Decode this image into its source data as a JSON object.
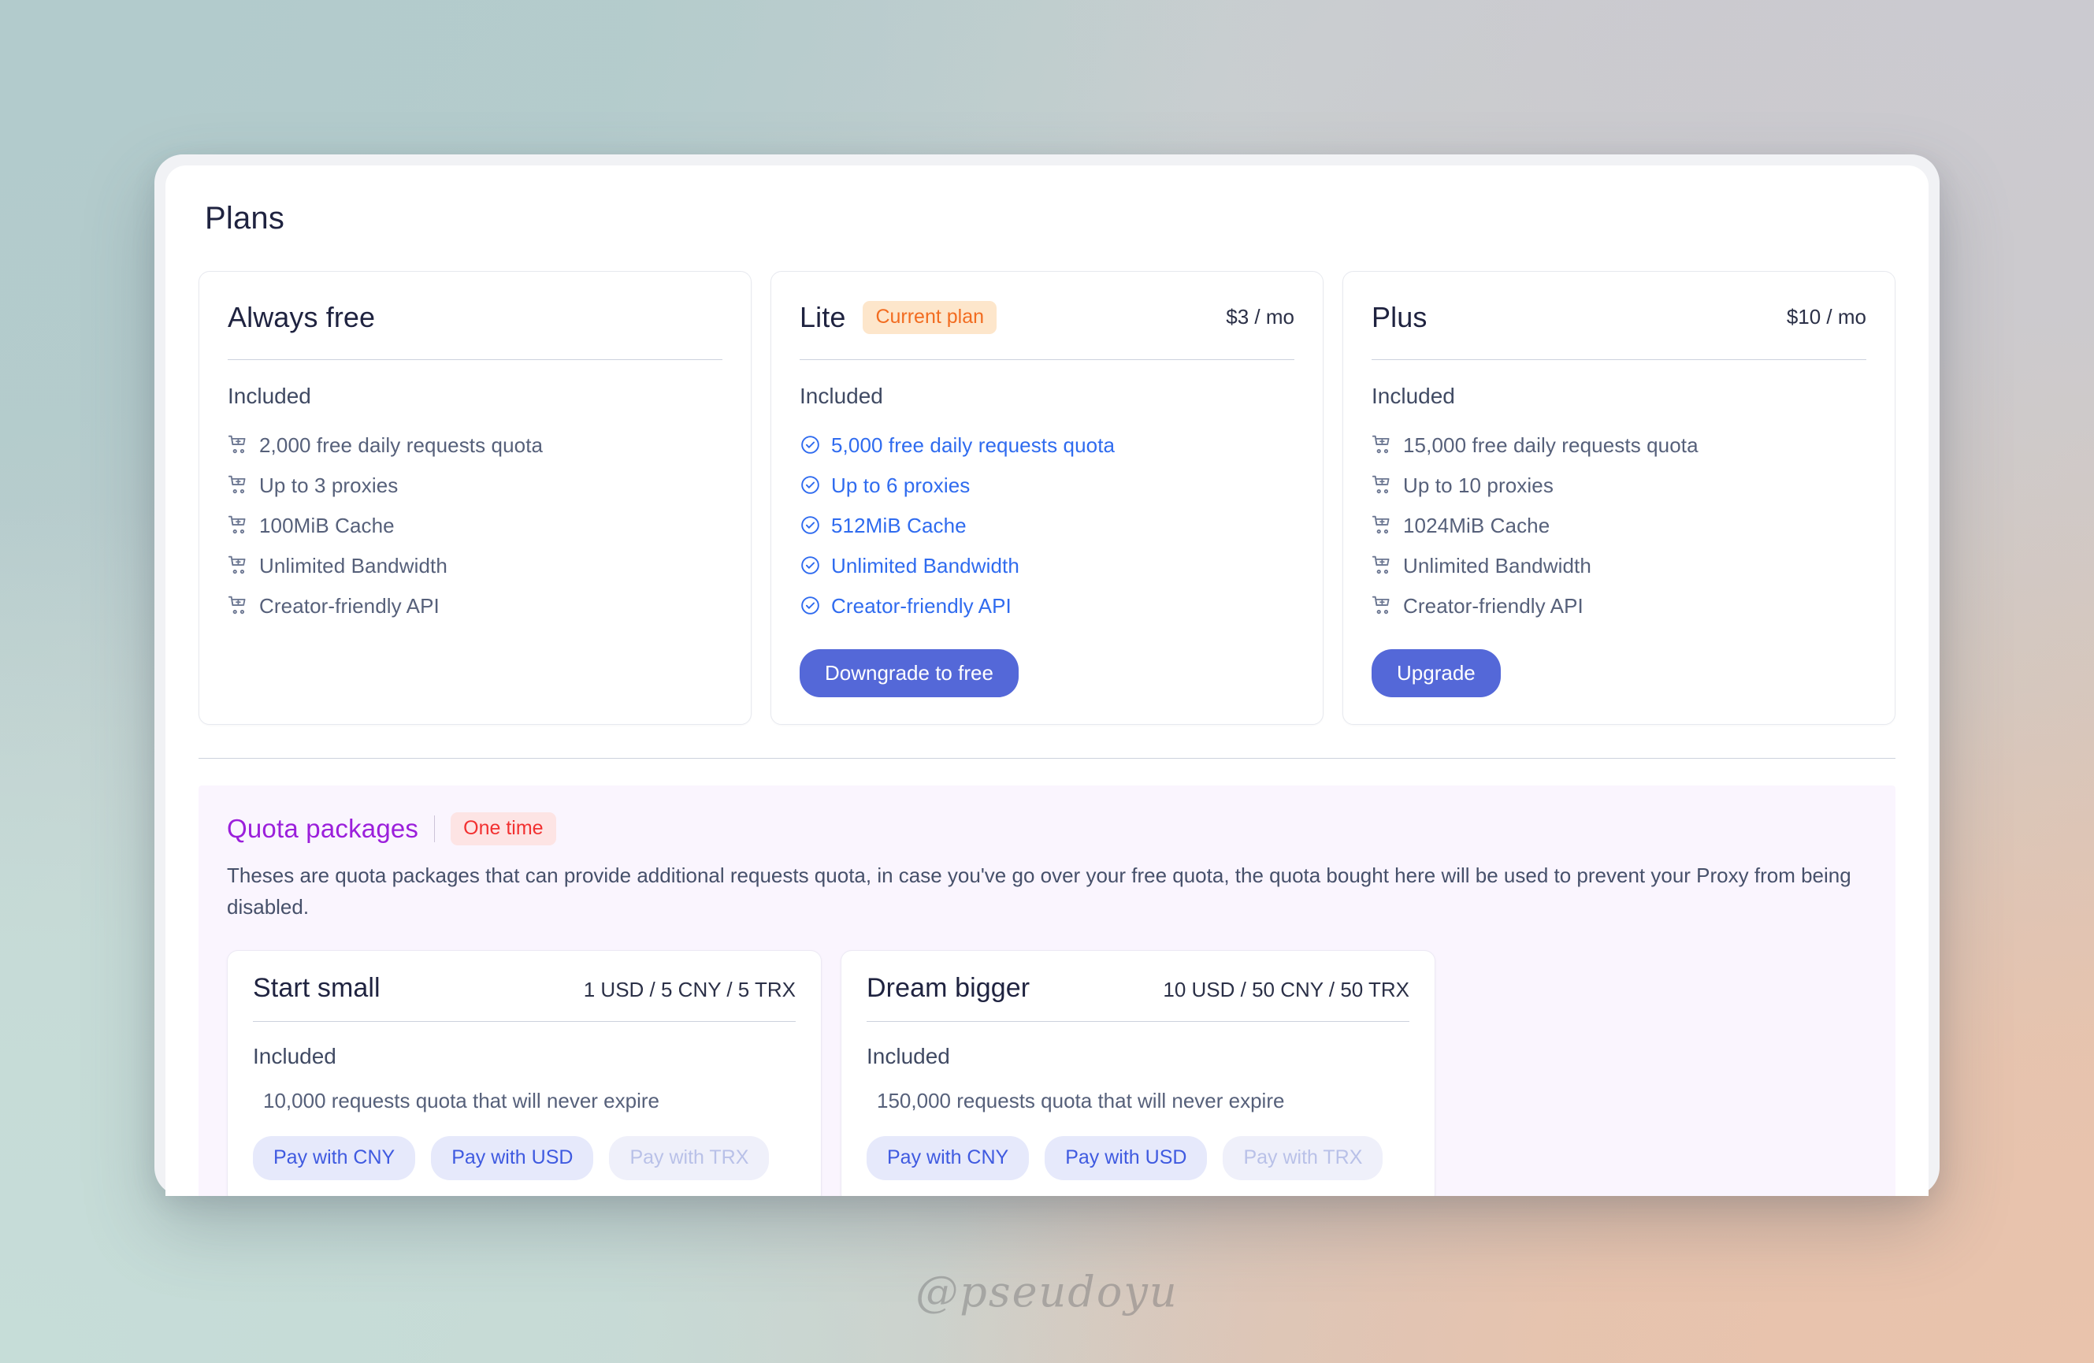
{
  "page": {
    "title": "Plans",
    "watermark": "@pseudoyu"
  },
  "colors": {
    "accent_blue": "#5468d8",
    "link_blue": "#2f6bef",
    "badge_current_bg": "#fde6cb",
    "badge_current_text": "#f26c20",
    "quota_title": "#9b1fdb",
    "badge_onetime_bg": "#fde4e4",
    "badge_onetime_text": "#f23030",
    "pay_btn_bg": "#e6e9fb",
    "pay_btn_text": "#3f5ae0"
  },
  "plans": {
    "included_label": "Included",
    "items": [
      {
        "name": "Always free",
        "badge": "",
        "price": "",
        "icon": "cart-plus-icon",
        "highlighted": false,
        "features": [
          "2,000 free daily requests quota",
          "Up to 3 proxies",
          "100MiB Cache",
          "Unlimited Bandwidth",
          "Creator-friendly API"
        ],
        "action": ""
      },
      {
        "name": "Lite",
        "badge": "Current plan",
        "price": "$3 / mo",
        "icon": "check-circle-icon",
        "highlighted": true,
        "features": [
          "5,000 free daily requests quota",
          "Up to 6 proxies",
          "512MiB Cache",
          "Unlimited Bandwidth",
          "Creator-friendly API"
        ],
        "action": "Downgrade to free"
      },
      {
        "name": "Plus",
        "badge": "",
        "price": "$10 / mo",
        "icon": "cart-plus-icon",
        "highlighted": false,
        "features": [
          "15,000 free daily requests quota",
          "Up to 10 proxies",
          "1024MiB Cache",
          "Unlimited Bandwidth",
          "Creator-friendly API"
        ],
        "action": "Upgrade"
      }
    ]
  },
  "quota": {
    "title": "Quota packages",
    "badge": "One time",
    "description": "Theses are quota packages that can provide additional requests quota, in case you've go over your free quota, the quota bought here will be used to prevent your Proxy from being disabled.",
    "included_label": "Included",
    "packages": [
      {
        "name": "Start small",
        "price": "1 USD / 5 CNY / 5 TRX",
        "feature": "10,000 requests quota that will never expire",
        "buttons": [
          {
            "label": "Pay with CNY",
            "disabled": false
          },
          {
            "label": "Pay with USD",
            "disabled": false
          },
          {
            "label": "Pay with TRX",
            "disabled": true
          }
        ]
      },
      {
        "name": "Dream bigger",
        "price": "10 USD / 50 CNY / 50 TRX",
        "feature": "150,000 requests quota that will never expire",
        "buttons": [
          {
            "label": "Pay with CNY",
            "disabled": false
          },
          {
            "label": "Pay with USD",
            "disabled": false
          },
          {
            "label": "Pay with TRX",
            "disabled": true
          }
        ]
      }
    ]
  }
}
